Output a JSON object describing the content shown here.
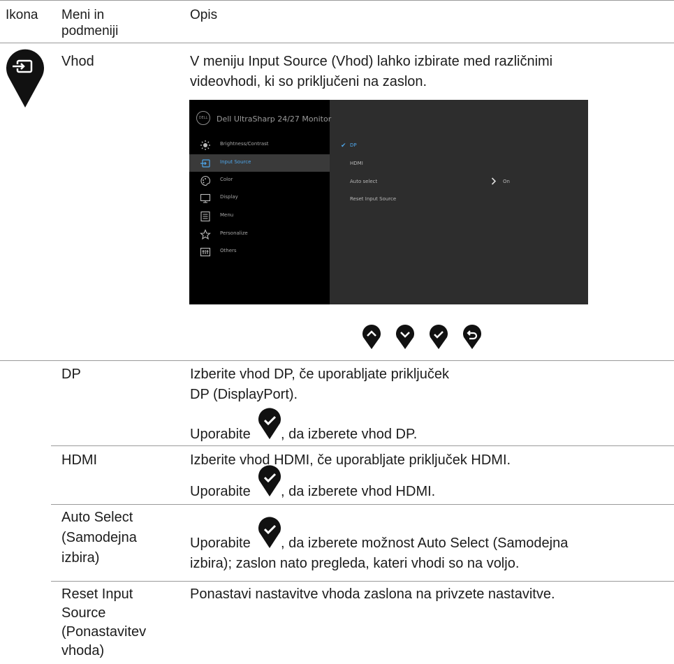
{
  "header": {
    "col_icon": "Ikona",
    "col_menu": "Meni in podmeniji",
    "col_desc": "Opis"
  },
  "vhod": {
    "name": "Vhod",
    "desc": "V meniju Input Source (Vhod) lahko izbirate med različnimi videovhodi, ki so priključeni na zaslon."
  },
  "osd": {
    "title": "Dell UltraSharp 24/27 Monitor",
    "logo": "DELL",
    "menu": [
      {
        "label": "Brightness/Contrast",
        "icon": "sun-icon"
      },
      {
        "label": "Input Source",
        "icon": "input-icon"
      },
      {
        "label": "Color",
        "icon": "palette-icon"
      },
      {
        "label": "Display",
        "icon": "display-icon"
      },
      {
        "label": "Menu",
        "icon": "menu-icon"
      },
      {
        "label": "Personalize",
        "icon": "star-icon"
      },
      {
        "label": "Others",
        "icon": "others-icon"
      }
    ],
    "options": [
      "DP",
      "HDMI",
      "Auto select",
      "Reset Input Source"
    ],
    "auto_value": "On",
    "accent": "#4ea6ea"
  },
  "rows": {
    "dp": {
      "name": "DP",
      "desc1": "Izberite vhod DP, če uporabljate priključek",
      "desc2": "DP (DisplayPort).",
      "use_prefix": "Uporabite",
      "use_suffix": ", da izberete vhod DP."
    },
    "hdmi": {
      "name": "HDMI",
      "desc": "Izberite vhod HDMI, če uporabljate priključek HDMI.",
      "use_prefix": "Uporabite",
      "use_suffix": ", da izberete vhod HDMI."
    },
    "auto": {
      "name1": "Auto Select",
      "name2": "(Samodejna",
      "name3": "izbira)",
      "use_prefix": "Uporabite",
      "desc1": ", da izberete možnost Auto Select (Samodejna",
      "desc2": "izbira); zaslon nato pregleda, kateri vhodi so na voljo."
    },
    "reset": {
      "name1": "Reset Input",
      "name2": "Source",
      "name3": "(Ponastavitev",
      "name4": "vhoda)",
      "desc": "Ponastavi nastavitve vhoda zaslona na privzete nastavitve."
    }
  }
}
